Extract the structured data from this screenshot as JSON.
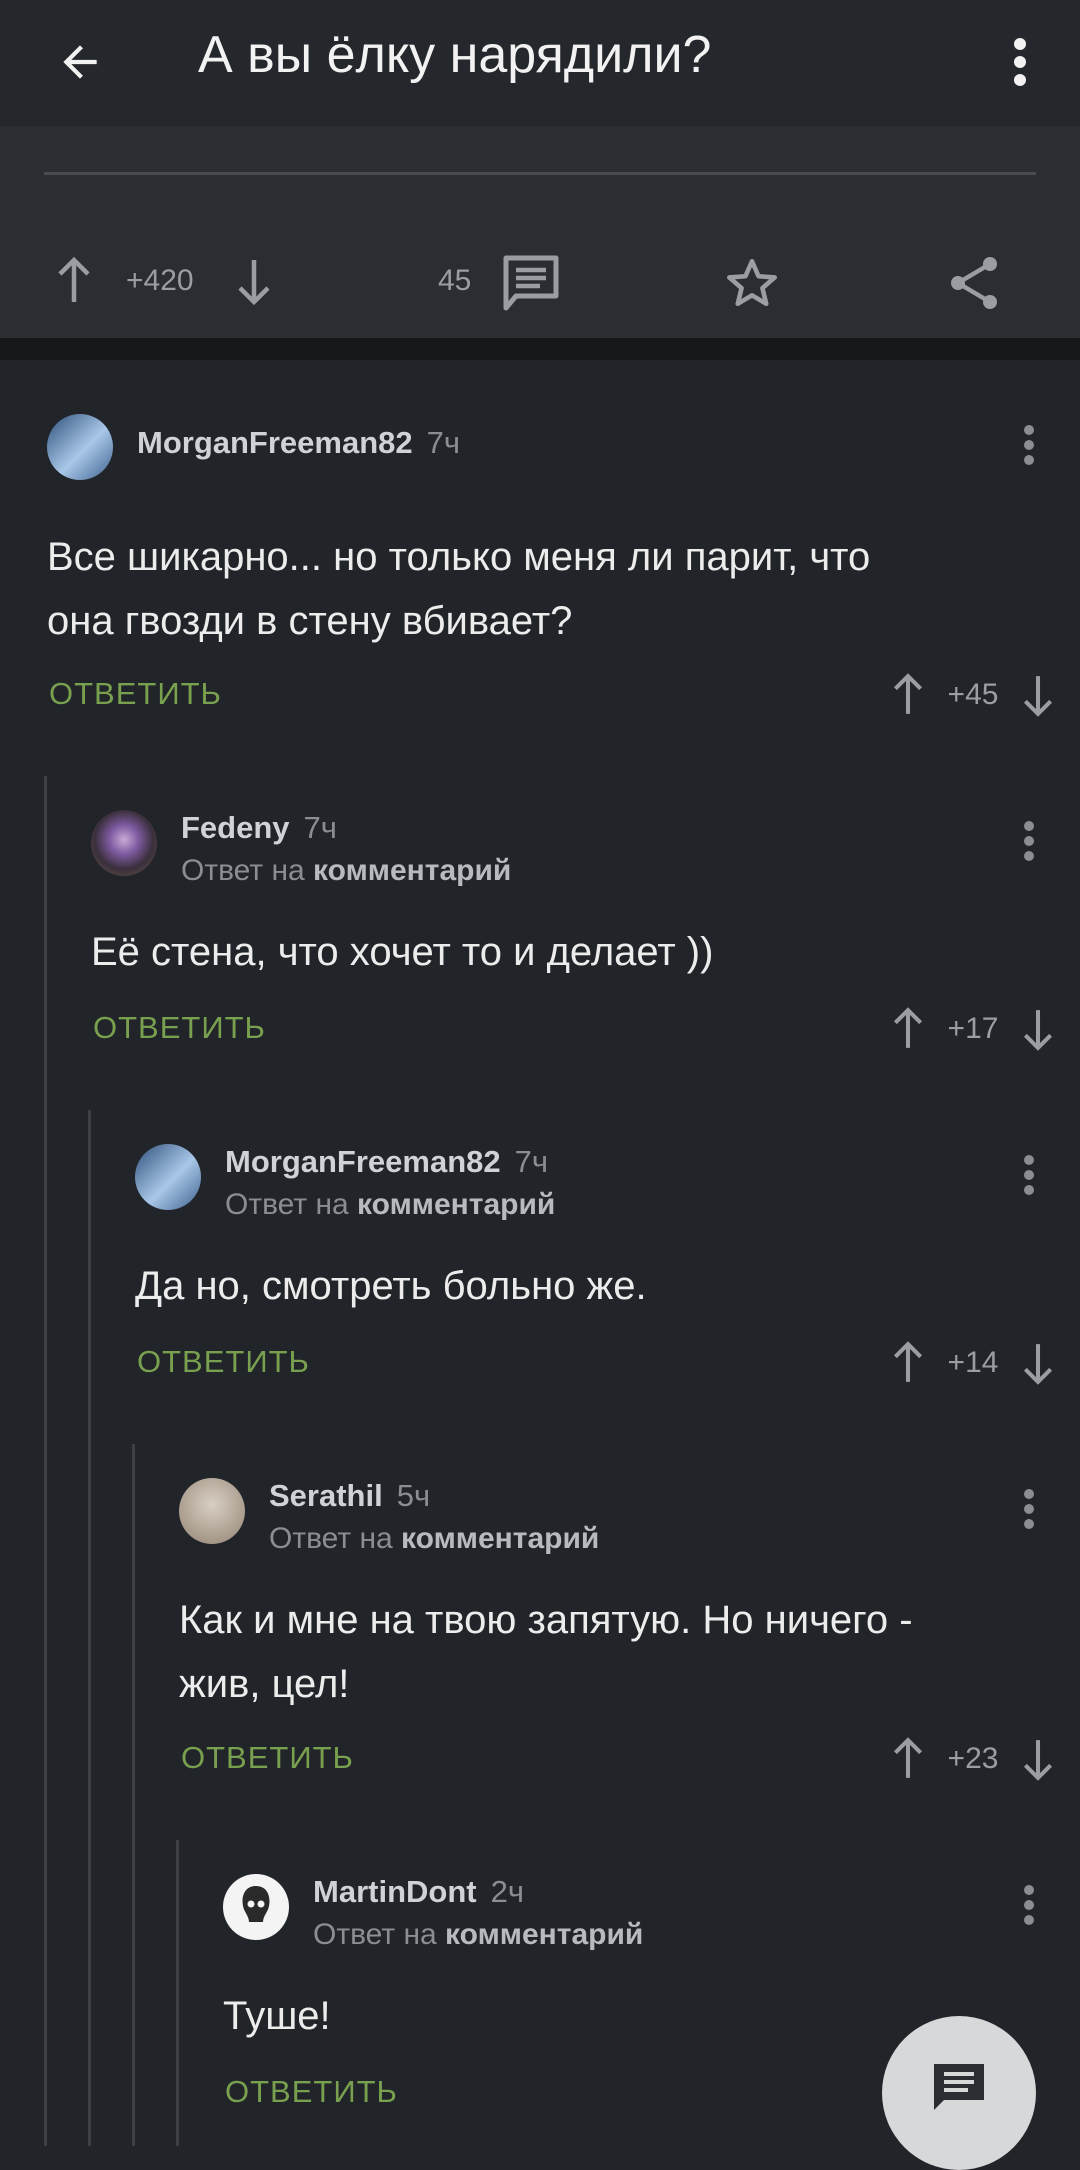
{
  "header": {
    "title": "А вы ёлку нарядили?"
  },
  "post": {
    "rating": "+420",
    "comments_count": "45"
  },
  "comments": [
    {
      "user": "MorganFreeman82",
      "time": "7ч",
      "reply_prefix": "",
      "reply_target": "",
      "text_lines": [
        "Все шикарно... но только меня ли парит, что",
        "она гвозди в стену вбивает?"
      ],
      "reply_label": "ОТВЕТИТЬ",
      "rating": "+45"
    },
    {
      "user": "Fedeny",
      "time": "7ч",
      "reply_prefix": "Ответ на ",
      "reply_target": "комментарий",
      "text_lines": [
        "Её стена, что хочет то и делает ))"
      ],
      "reply_label": "ОТВЕТИТЬ",
      "rating": "+17"
    },
    {
      "user": "MorganFreeman82",
      "time": "7ч",
      "reply_prefix": "Ответ на ",
      "reply_target": "комментарий",
      "text_lines": [
        "Да но, смотреть больно же."
      ],
      "reply_label": "ОТВЕТИТЬ",
      "rating": "+14"
    },
    {
      "user": "Serathil",
      "time": "5ч",
      "reply_prefix": "Ответ на ",
      "reply_target": "комментарий",
      "text_lines": [
        "Как и мне на твою запятую. Но ничего -",
        "жив, цел!"
      ],
      "reply_label": "ОТВЕТИТЬ",
      "rating": "+23"
    },
    {
      "user": "MartinDont",
      "time": "2ч",
      "reply_prefix": "Ответ на ",
      "reply_target": "комментарий",
      "text_lines": [
        "Туше!"
      ],
      "reply_label": "ОТВЕТИТЬ",
      "rating": ""
    }
  ],
  "colors": {
    "background": "#212428",
    "reply_green": "#78a04e",
    "fab": "#d7d8da"
  },
  "icons": [
    "arrow-left-icon",
    "more-vertical-icon",
    "arrow-up-icon",
    "arrow-down-icon",
    "comment-icon",
    "star-icon",
    "share-icon"
  ]
}
